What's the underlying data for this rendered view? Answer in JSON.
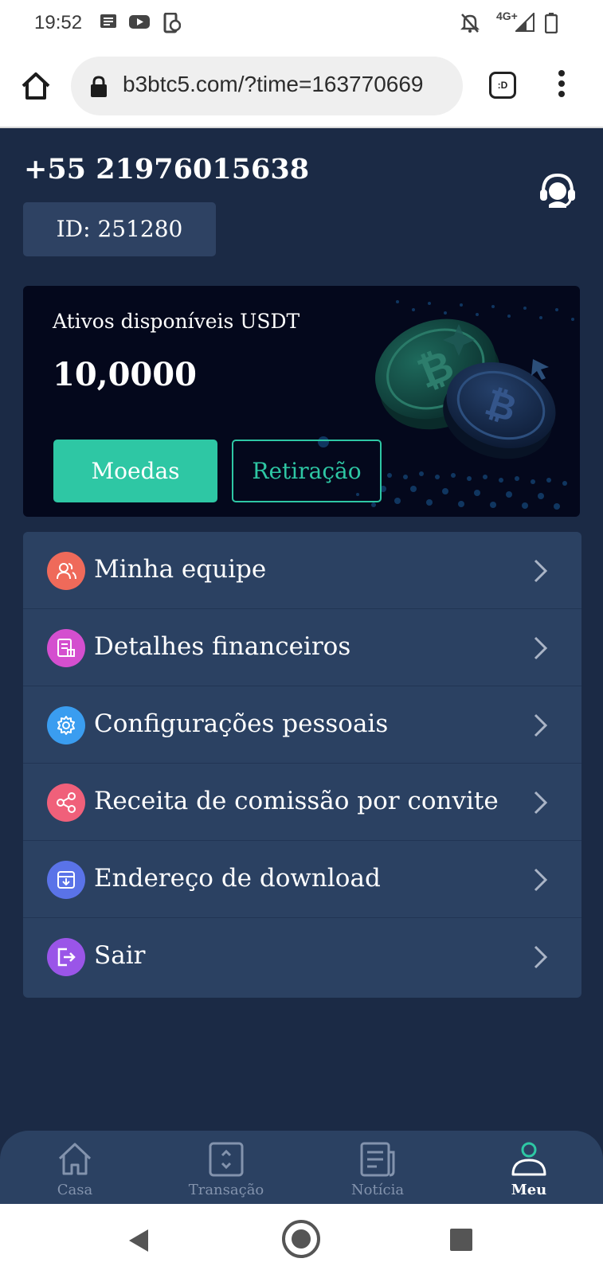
{
  "status_bar": {
    "time": "19:52",
    "network": "4G+",
    "icons": [
      "message-icon",
      "youtube-icon",
      "phone-sync-icon",
      "notifications-off-icon",
      "signal-icon",
      "battery-icon"
    ]
  },
  "browser": {
    "url": "b3btc5.com/?time=163770669",
    "extension_label": ":D",
    "icons": [
      "home-icon",
      "lock-icon",
      "more-vert-icon"
    ]
  },
  "profile": {
    "phone": "+55 21976015638",
    "id_label": "ID: 251280",
    "support_icon": "headset-support-icon"
  },
  "assets_card": {
    "label": "Ativos disponíveis USDT",
    "value": "10,0000",
    "primary_button": "Moedas",
    "secondary_button": "Retiração",
    "accent_color": "#2ec7a4"
  },
  "menu": {
    "items": [
      {
        "label": "Minha equipe",
        "icon": "team-icon",
        "color": "#ef6a5a"
      },
      {
        "label": "Detalhes financeiros",
        "icon": "document-icon",
        "color": "#d44fcf"
      },
      {
        "label": "Configurações pessoais",
        "icon": "gear-icon",
        "color": "#3a9df0"
      },
      {
        "label": "Receita de comissão por convite",
        "icon": "share-icon",
        "color": "#f0607a"
      },
      {
        "label": "Endereço de download",
        "icon": "download-icon",
        "color": "#5a73e8"
      },
      {
        "label": "Sair",
        "icon": "logout-icon",
        "color": "#9a55e8"
      }
    ]
  },
  "bottom_nav": {
    "items": [
      {
        "label": "Casa",
        "icon": "home-outline-icon",
        "active": false
      },
      {
        "label": "Transação",
        "icon": "transaction-icon",
        "active": false
      },
      {
        "label": "Notícia",
        "icon": "news-icon",
        "active": false
      },
      {
        "label": "Meu",
        "icon": "user-icon",
        "active": true
      }
    ]
  },
  "system_nav": {
    "icons": [
      "back-icon",
      "home-circle-icon",
      "recents-icon"
    ]
  }
}
